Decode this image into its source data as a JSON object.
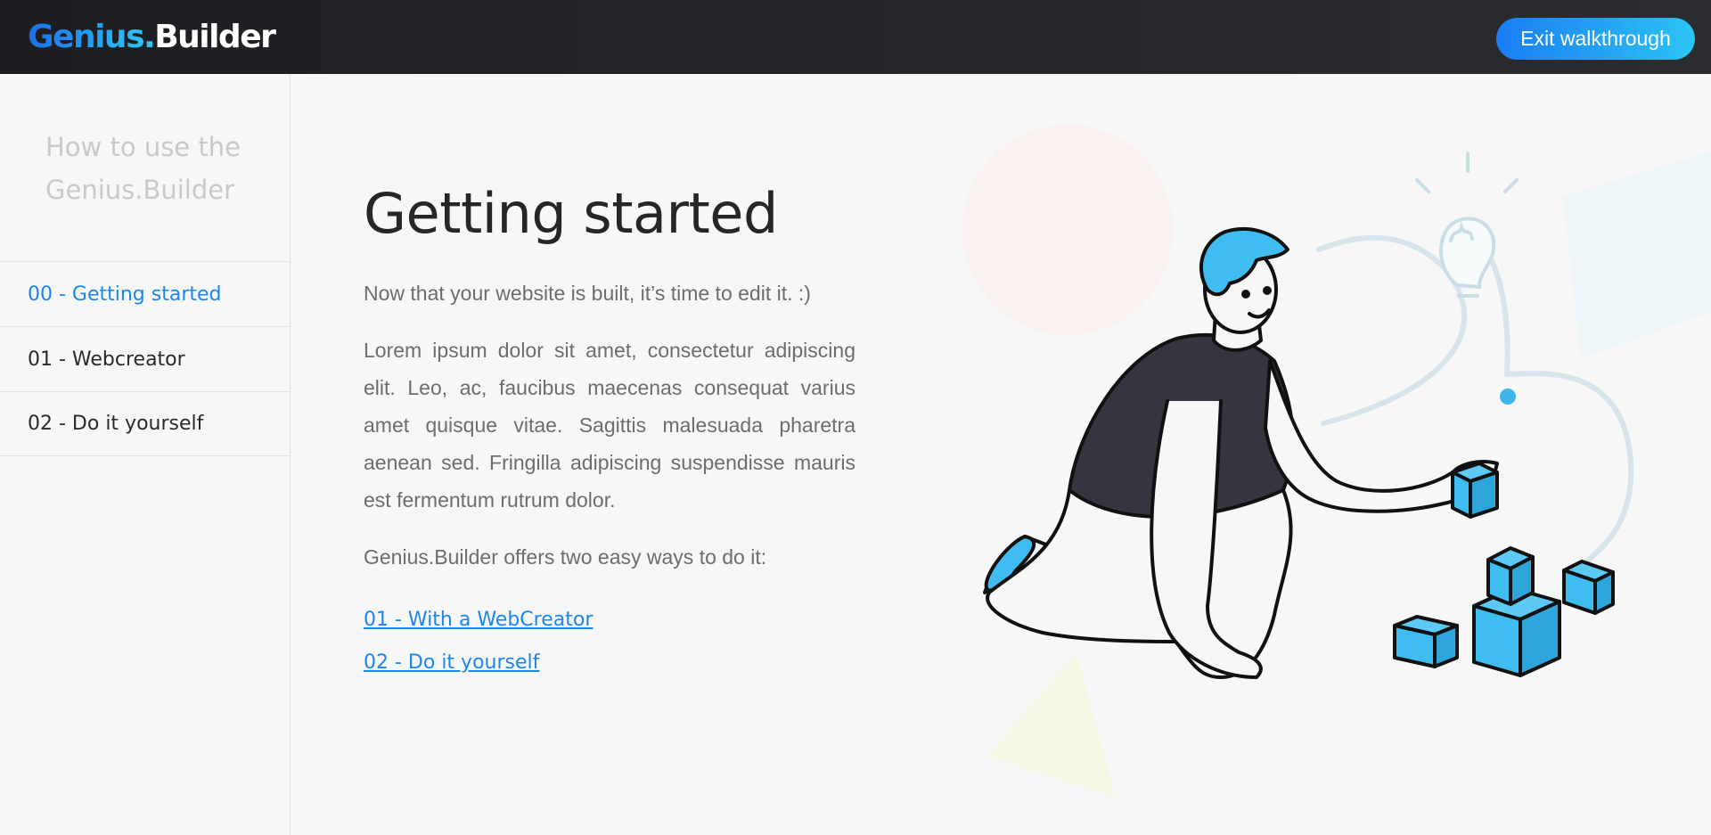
{
  "header": {
    "logo": {
      "brand": "Genius",
      "dot": ".",
      "suffix": "Builder"
    },
    "exit_button": "Exit walkthrough"
  },
  "sidebar": {
    "title": "How to use the Genius.Builder",
    "items": [
      {
        "label": "00 - Getting started",
        "active": true
      },
      {
        "label": "01 - Webcreator",
        "active": false
      },
      {
        "label": "02 - Do it yourself",
        "active": false
      }
    ]
  },
  "main": {
    "title": "Getting started",
    "intro": "Now that your website is built, it’s time to edit it. :)",
    "paragraph": "Lorem ipsum dolor sit amet, consectetur adipiscing elit. Leo, ac, faucibus maecenas consequat varius amet quisque vitae. Sagittis malesuada pharetra aenean sed. Fringilla adipiscing suspendisse mauris est fermentum rutrum dolor.",
    "offers": "Genius.Builder offers two easy ways to do it:",
    "links": [
      {
        "label": "01 - With a WebCreator"
      },
      {
        "label": "02 - Do it yourself"
      }
    ]
  },
  "colors": {
    "accent": "#1c86ef",
    "button_gradient_start": "#1a7df5",
    "button_gradient_end": "#2cc4f3",
    "header_bg": "#1d1e21",
    "cube_blue": "#3fbdf0",
    "shirt": "#35353f"
  }
}
